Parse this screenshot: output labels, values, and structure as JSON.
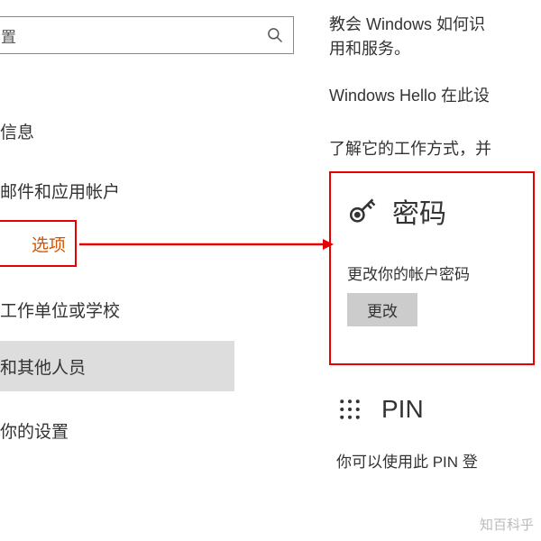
{
  "search": {
    "placeholder": "置"
  },
  "nav": {
    "info": "信息",
    "email": "邮件和应用帐户",
    "options": "选项",
    "work": "工作单位或学校",
    "others": "和其他人员",
    "settings": "你的设置"
  },
  "right": {
    "teach_line1": "教会 Windows 如何识",
    "teach_line2": "用和服务。",
    "hello": "Windows Hello 在此设",
    "learn": "了解它的工作方式，并"
  },
  "password": {
    "title": "密码",
    "subtitle": "更改你的帐户密码",
    "button": "更改"
  },
  "pin": {
    "title": "PIN",
    "text": "你可以使用此 PIN 登"
  },
  "watermark": "知百科乎"
}
